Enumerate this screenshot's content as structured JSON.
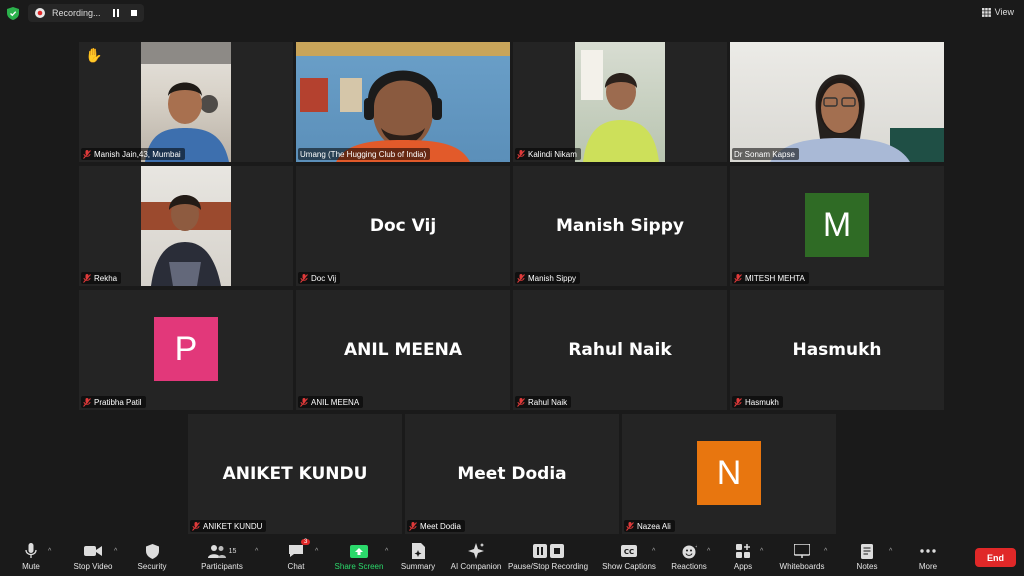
{
  "topbar": {
    "recording_text": "Recording...",
    "view_label": "View"
  },
  "participants": {
    "manish_jain": "Manish Jain,43, Mumbai",
    "umang": "Umang (The Hugging Club of India)",
    "kalindi": "Kalindi Nikam",
    "sonam": "Dr Sonam Kapse",
    "rekha": "Rekha",
    "doc_vij": "Doc Vij",
    "manish_sippy": "Manish Sippy",
    "mitesh": "MITESH MEHTA",
    "pratibha": "Pratibha Patil",
    "anil": "ANIL MEENA",
    "rahul": "Rahul Naik",
    "hasmukh": "Hasmukh",
    "aniket": "ANIKET KUNDU",
    "meet": "Meet Dodia",
    "nazea": "Nazea Ali"
  },
  "avatars": {
    "mitesh": {
      "letter": "M",
      "color": "#2f6b25"
    },
    "pratibha": {
      "letter": "P",
      "color": "#e2387a"
    },
    "nazea": {
      "letter": "N",
      "color": "#e8760f"
    }
  },
  "toolbar": {
    "mute": "Mute",
    "stop_video": "Stop Video",
    "security": "Security",
    "participants": "Participants",
    "participants_count": "15",
    "chat": "Chat",
    "chat_badge": "3",
    "share_screen": "Share Screen",
    "summary": "Summary",
    "ai_companion": "AI Companion",
    "pause_stop_recording": "Pause/Stop Recording",
    "show_captions": "Show Captions",
    "reactions": "Reactions",
    "apps": "Apps",
    "whiteboards": "Whiteboards",
    "notes": "Notes",
    "more": "More",
    "end": "End"
  },
  "colors": {
    "active_speaker": "#c6e25a",
    "share_green": "#2bd96b",
    "end_red": "#e02828"
  }
}
